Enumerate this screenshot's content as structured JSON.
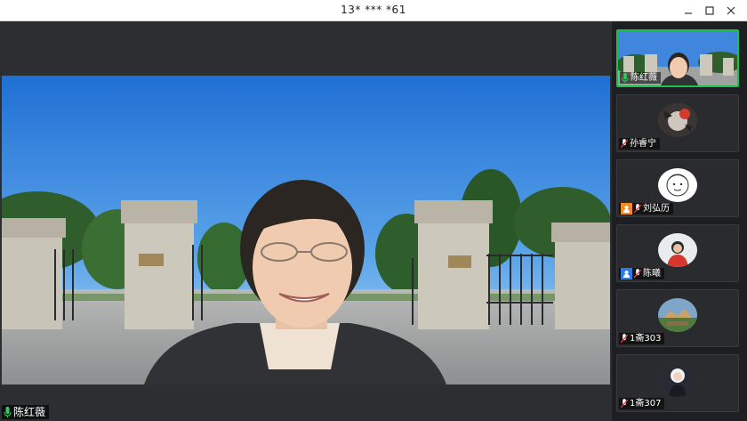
{
  "window": {
    "title": "13* *** *61",
    "controls": [
      "minimize-icon",
      "maximize-icon",
      "close-icon"
    ]
  },
  "main_video": {
    "speaker_name": "陈红薇",
    "mic_state": "active",
    "background": "park-gate-virtual-background"
  },
  "participants": [
    {
      "name": "陈红薇",
      "mic": "active",
      "role_badge": null,
      "active_speaker": true,
      "view": "video"
    },
    {
      "name": "孙睿宁",
      "mic": "muted",
      "role_badge": null,
      "active_speaker": false,
      "view": "avatar"
    },
    {
      "name": "刘弘历",
      "mic": "muted",
      "role_badge": "host",
      "active_speaker": false,
      "view": "avatar"
    },
    {
      "name": "陈曦",
      "mic": "muted",
      "role_badge": "co-host",
      "active_speaker": false,
      "view": "avatar"
    },
    {
      "name": "1斋303",
      "mic": "muted",
      "role_badge": null,
      "active_speaker": false,
      "view": "avatar"
    },
    {
      "name": "1斋307",
      "mic": "muted",
      "role_badge": null,
      "active_speaker": false,
      "view": "avatar"
    }
  ],
  "colors": {
    "active_border": "#1fbf4a",
    "host_badge": "#f08a24",
    "cohost_badge": "#2d7be5",
    "mic_active": "#2fd05a",
    "mic_muted": "#e23b3b"
  }
}
